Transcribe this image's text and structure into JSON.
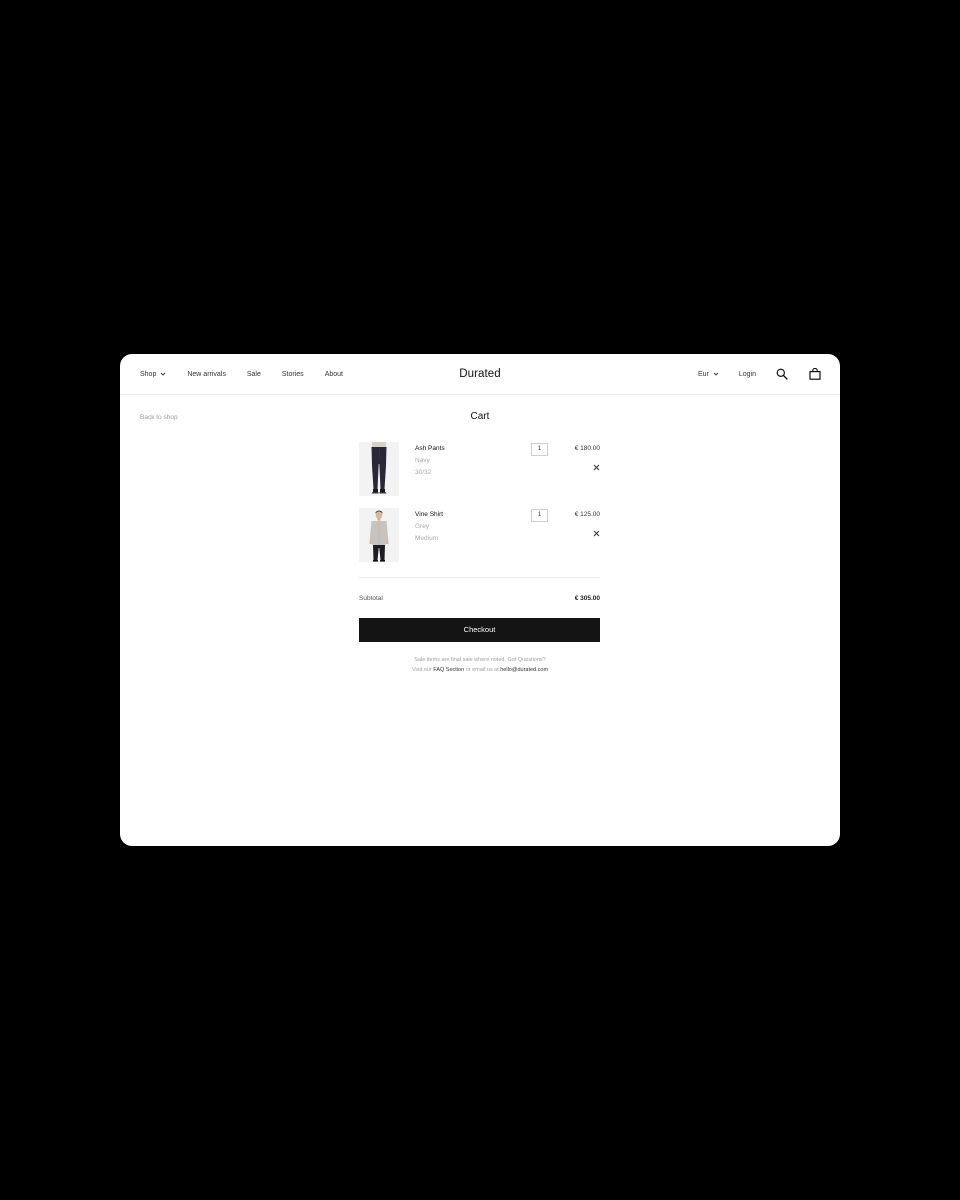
{
  "header": {
    "nav": [
      {
        "label": "Shop",
        "has_dropdown": true
      },
      {
        "label": "New arrivals",
        "has_dropdown": false
      },
      {
        "label": "Sale",
        "has_dropdown": false
      },
      {
        "label": "Stories",
        "has_dropdown": false
      },
      {
        "label": "About",
        "has_dropdown": false
      }
    ],
    "logo": "Durated",
    "currency": "Eur",
    "login": "Login",
    "icons": [
      "search-icon",
      "bag-icon"
    ]
  },
  "page": {
    "back_link": "Back to shop",
    "title": "Cart"
  },
  "cart": {
    "items": [
      {
        "name": "Ash Pants",
        "color": "Navy",
        "size": "30/32",
        "qty": "1",
        "price": "€ 180.00"
      },
      {
        "name": "Vine Shirt",
        "color": "Grey",
        "size": "Medium",
        "qty": "1",
        "price": "€ 125.00"
      }
    ],
    "subtotal_label": "Subtotal",
    "subtotal_value": "€ 305.00",
    "checkout_label": "Checkout"
  },
  "note": {
    "line1": "Sale items are final sale where noted. Got Questions?",
    "line2_prefix": "Visit our",
    "faq_link": "FAQ Section",
    "line2_middle": "or email us at",
    "email_link": "hello@durated.com"
  },
  "colors": {
    "background": "#000000",
    "surface": "#ffffff",
    "button": "#141414",
    "muted_text": "#a8a8a8"
  }
}
